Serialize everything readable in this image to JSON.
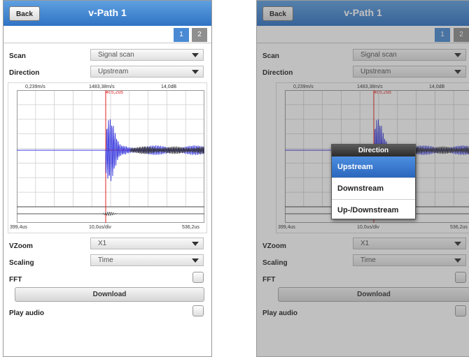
{
  "app": {
    "title": "v-Path 1",
    "back_label": "Back",
    "tabs": [
      "1",
      "2"
    ],
    "active_tab": "1"
  },
  "settings": {
    "scan": {
      "label": "Scan",
      "value": "Signal scan"
    },
    "direction": {
      "label": "Direction",
      "value": "Upstream"
    },
    "vzoom": {
      "label": "VZoom",
      "value": "X1"
    },
    "scaling": {
      "label": "Scaling",
      "value": "Time"
    },
    "fft": {
      "label": "FFT",
      "checked": false
    },
    "download_label": "Download",
    "play_audio": {
      "label": "Play audio",
      "checked": false
    }
  },
  "plot": {
    "top_left": "0,239m/s",
    "top_center": "1483,38m/s",
    "top_right": "14,0dB",
    "marker": "465,2us",
    "bottom_left": "399,4us",
    "bottom_center": "10,0us/div",
    "bottom_right": "536,2us"
  },
  "direction_popup": {
    "title": "Direction",
    "options": [
      "Upstream",
      "Downstream",
      "Up-/Downstream"
    ],
    "selected": "Upstream"
  },
  "colors": {
    "header": "#3a80cc",
    "tab_active": "#4a8ad4",
    "waveform": "#3333dd",
    "marker": "#e02020",
    "popup_selected": "#3a78cc"
  }
}
